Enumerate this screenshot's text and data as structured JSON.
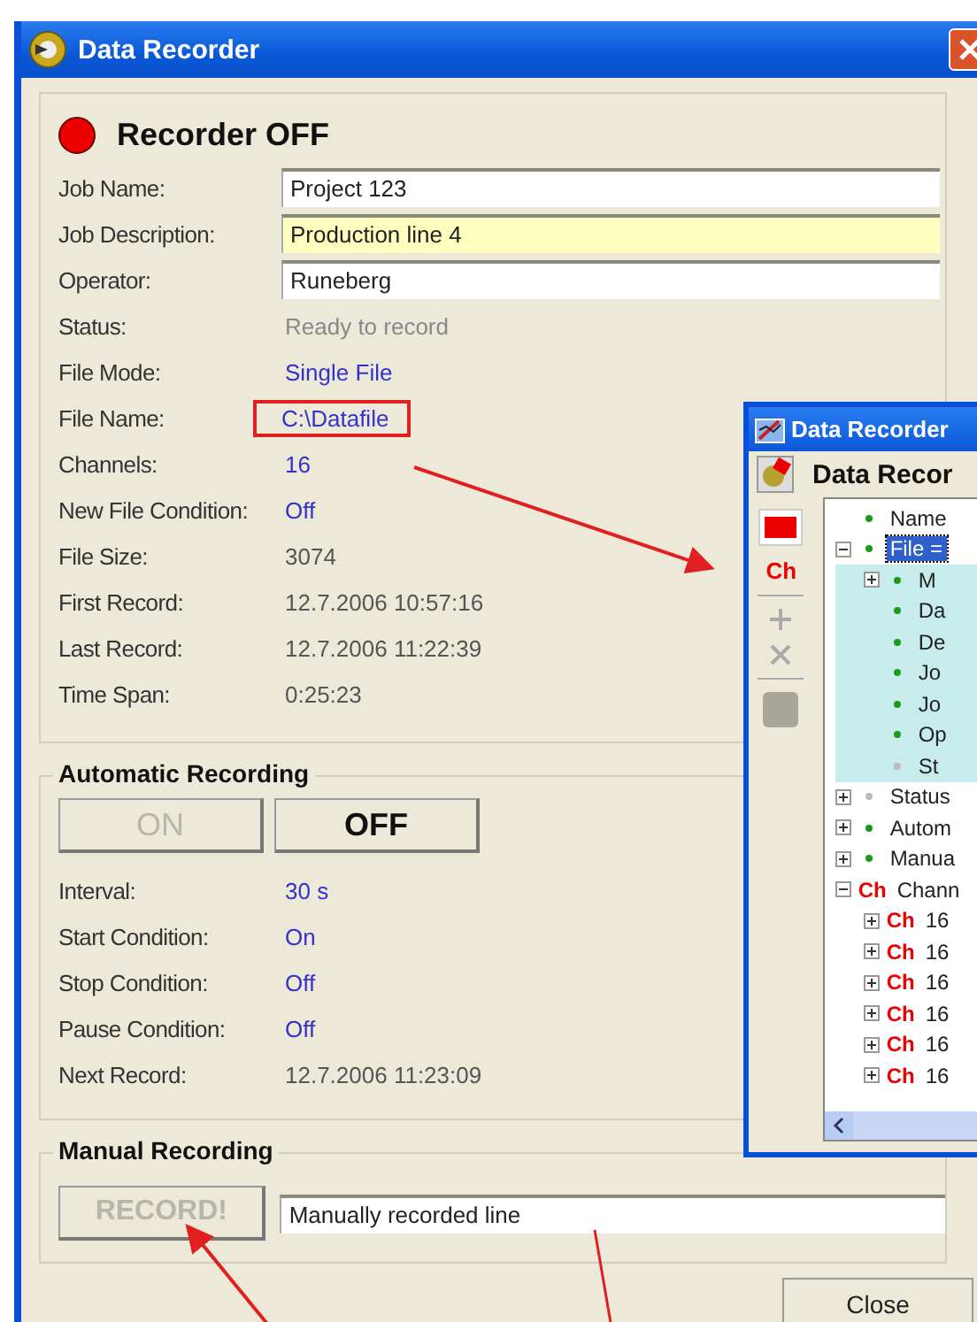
{
  "window": {
    "title": "Data Recorder"
  },
  "recorder": {
    "title": "Recorder OFF",
    "recording": false
  },
  "fields": [
    {
      "label": "Job Name:",
      "value": "Project 123",
      "focused": false
    },
    {
      "label": "Job Description:",
      "value": "Production line 4",
      "focused": true
    },
    {
      "label": "Operator:",
      "value": "Runeberg",
      "focused": false
    }
  ],
  "info": [
    {
      "label": "Status:",
      "value": "Ready to record",
      "kind": "status",
      "highlighted": false
    },
    {
      "label": "File Mode:",
      "value": "Single File",
      "kind": "setting",
      "highlighted": false
    },
    {
      "label": "File Name:",
      "value": "C:\\Datafile",
      "kind": "setting",
      "highlighted": true
    },
    {
      "label": "Channels:",
      "value": "16",
      "kind": "setting",
      "highlighted": false
    },
    {
      "label": "New File Condition:",
      "value": "Off",
      "kind": "setting",
      "highlighted": false
    },
    {
      "label": "File Size:",
      "value": "3074",
      "kind": "plain",
      "highlighted": false
    },
    {
      "label": "First Record:",
      "value": "12.7.2006 10:57:16",
      "kind": "plain",
      "highlighted": false
    },
    {
      "label": "Last Record:",
      "value": "12.7.2006 11:22:39",
      "kind": "plain",
      "highlighted": false
    },
    {
      "label": "Time Span:",
      "value": "0:25:23",
      "kind": "plain",
      "highlighted": false
    }
  ],
  "automatic": {
    "title": "Automatic Recording",
    "buttons": [
      {
        "label": "ON",
        "disabled": true
      },
      {
        "label": "OFF",
        "disabled": false
      }
    ],
    "rows": [
      {
        "label": "Interval:",
        "value": "30 s",
        "kind": "setting"
      },
      {
        "label": "Start Condition:",
        "value": "On",
        "kind": "setting"
      },
      {
        "label": "Stop Condition:",
        "value": "Off",
        "kind": "setting"
      },
      {
        "label": "Pause Condition:",
        "value": "Off",
        "kind": "setting"
      },
      {
        "label": "Next Record:",
        "value": "12.7.2006 11:23:09",
        "kind": "plain"
      }
    ]
  },
  "manual": {
    "title": "Manual Recording",
    "button": {
      "label": "RECORD!",
      "disabled": true
    },
    "line": {
      "value": "Manually recorded line"
    }
  },
  "close_button": "Close",
  "tree_window": {
    "title": "Data Recorder",
    "heading": "Data Recor",
    "tools": [
      {
        "kind": "pro"
      },
      {
        "kind": "text",
        "text": "Ch"
      },
      {
        "kind": "separator"
      },
      {
        "kind": "add"
      },
      {
        "kind": "delete"
      },
      {
        "kind": "separator"
      },
      {
        "kind": "stop"
      }
    ],
    "tree": [
      {
        "label": "Name",
        "kind": "active",
        "selected": false
      },
      {
        "label": "File =",
        "kind": "active",
        "selected": true,
        "expanded": true,
        "children": [
          {
            "label": "M",
            "kind": "active",
            "selected": false,
            "expanded": false
          },
          {
            "label": "Da",
            "kind": "active",
            "selected": false
          },
          {
            "label": "De",
            "kind": "active",
            "selected": false
          },
          {
            "label": "Jo",
            "kind": "active",
            "selected": false
          },
          {
            "label": "Jo",
            "kind": "active",
            "selected": false
          },
          {
            "label": "Op",
            "kind": "active",
            "selected": false
          },
          {
            "label": "St",
            "kind": "inactive",
            "selected": false
          }
        ]
      },
      {
        "label": "Status",
        "kind": "inactive",
        "selected": false,
        "expanded": false
      },
      {
        "label": "Autom",
        "kind": "active",
        "selected": false,
        "expanded": false
      },
      {
        "label": "Manua",
        "kind": "active",
        "selected": false,
        "expanded": false
      },
      {
        "label": "Chann",
        "kind": "channel",
        "badge": "Ch",
        "selected": false,
        "expanded": true,
        "children": [
          {
            "label": "16",
            "kind": "channel",
            "badge": "Ch",
            "selected": false,
            "expanded": false
          },
          {
            "label": "16",
            "kind": "channel",
            "badge": "Ch",
            "selected": false,
            "expanded": false
          },
          {
            "label": "16",
            "kind": "channel",
            "badge": "Ch",
            "selected": false,
            "expanded": false
          },
          {
            "label": "16",
            "kind": "channel",
            "badge": "Ch",
            "selected": false,
            "expanded": false
          },
          {
            "label": "16",
            "kind": "channel",
            "badge": "Ch",
            "selected": false,
            "expanded": false
          },
          {
            "label": "16",
            "kind": "channel",
            "badge": "Ch",
            "selected": false,
            "expanded": false
          }
        ]
      }
    ]
  }
}
